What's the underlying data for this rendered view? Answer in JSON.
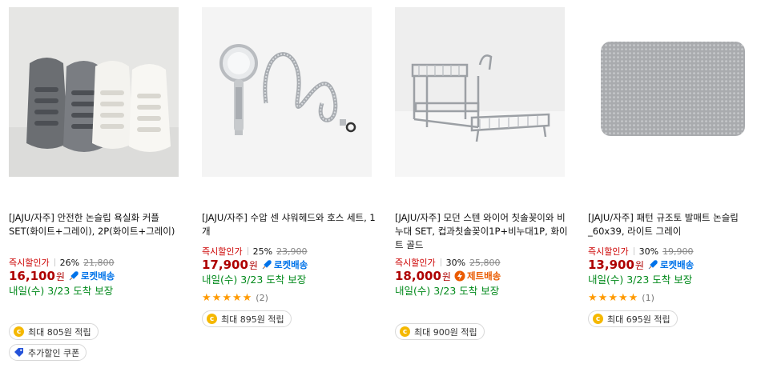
{
  "products": [
    {
      "title": "[JAJU/자주] 안전한 논슬립 욕실화 커플SET(화이트+그레이), 2P(화이트+그레이)",
      "discount_label": "즉시할인가",
      "rate": "26%",
      "original_price": "21,800",
      "price": "16,100",
      "won": "원",
      "badge": "로켓배송",
      "delivery": "내일(수) 3/23 도착 보장",
      "reward": "최대 805원 적립",
      "coupon": "추가할인 쿠폰"
    },
    {
      "title": "[JAJU/자주] 수압 센 샤워헤드와 호스 세트, 1개",
      "discount_label": "즉시할인가",
      "rate": "25%",
      "original_price": "23,900",
      "price": "17,900",
      "won": "원",
      "badge": "로켓배송",
      "delivery": "내일(수) 3/23 도착 보장",
      "rating": 5,
      "review_count": "(2)",
      "reward": "최대 895원 적립"
    },
    {
      "title": "[JAJU/자주] 모던 스텐 와이어 칫솔꽂이와 비누대 SET, 컵과칫솔꽂이1P+비누대1P, 화이트 골드",
      "discount_label": "즉시할인가",
      "rate": "30%",
      "original_price": "25,800",
      "price": "18,000",
      "won": "원",
      "badge": "제트배송",
      "delivery": "내일(수) 3/23 도착 보장",
      "reward": "최대 900원 적립"
    },
    {
      "title": "[JAJU/자주] 패턴 규조토 발매트 논슬립_60x39, 라이트 그레이",
      "discount_label": "즉시할인가",
      "rate": "30%",
      "original_price": "19,900",
      "price": "13,900",
      "won": "원",
      "badge": "로켓배송",
      "delivery": "내일(수) 3/23 도착 보장",
      "rating": 5,
      "review_count": "(1)",
      "reward": "최대 695원 적립"
    }
  ],
  "icons": {
    "rocket": "rocket-icon",
    "jet": "lightning-icon",
    "coin": "coin-icon",
    "coupon": "coupon-tag-icon",
    "star": "star-icon"
  },
  "colors": {
    "price": "#ae0000",
    "discount_label": "#cc0000",
    "rocket": "#0073e9",
    "jet": "#ea5b00",
    "delivery": "#00891a",
    "star": "#ff9a00",
    "coin": "#f5b800"
  }
}
